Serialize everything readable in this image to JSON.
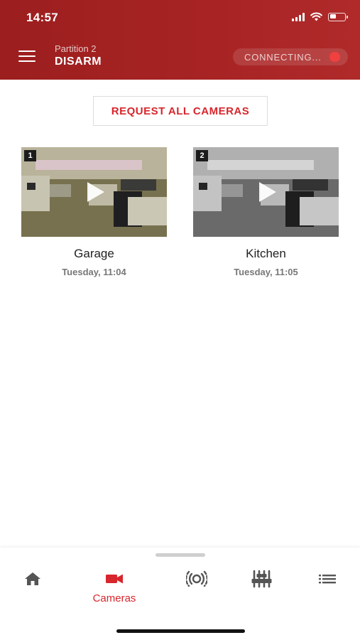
{
  "status_bar": {
    "time": "14:57"
  },
  "header": {
    "partition_label": "Partition 2",
    "partition_state": "DISARM",
    "connection_status": "CONNECTING...",
    "connection_dot_color": "#f04040"
  },
  "request_button": {
    "label": "REQUEST ALL CAMERAS"
  },
  "cameras": [
    {
      "number": "1",
      "name": "Garage",
      "timestamp": "Tuesday, 11:04",
      "tint": "color"
    },
    {
      "number": "2",
      "name": "Kitchen",
      "timestamp": "Tuesday, 11:05",
      "tint": "grayscale"
    }
  ],
  "bottom_nav": {
    "tabs": [
      {
        "icon": "home-icon",
        "label": "",
        "active": false
      },
      {
        "icon": "video-camera-icon",
        "label": "Cameras",
        "active": true
      },
      {
        "icon": "sensor-icon",
        "label": "",
        "active": false
      },
      {
        "icon": "sliders-icon",
        "label": "",
        "active": false
      },
      {
        "icon": "list-icon",
        "label": "",
        "active": false
      }
    ]
  },
  "colors": {
    "brand_red": "#a82424",
    "accent_red": "#d7262c",
    "icon_gray": "#555555"
  }
}
